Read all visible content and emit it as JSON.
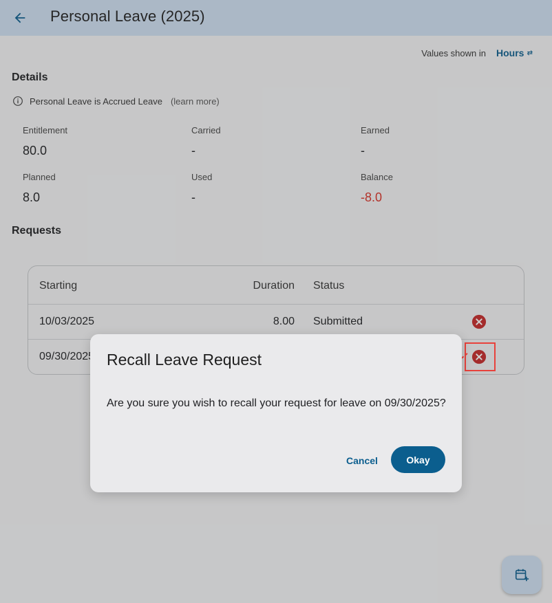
{
  "appbar": {
    "title": "Personal Leave (2025)"
  },
  "units": {
    "prefix": "Values shown in",
    "value": "Hours"
  },
  "details": {
    "title": "Details",
    "info_text": "Personal Leave is Accrued Leave",
    "learn_more": "(learn more)",
    "stats": [
      {
        "label": "Entitlement",
        "value": "80.0"
      },
      {
        "label": "Carried",
        "value": "-"
      },
      {
        "label": "Earned",
        "value": "-"
      },
      {
        "label": "Planned",
        "value": "8.0"
      },
      {
        "label": "Used",
        "value": "-"
      },
      {
        "label": "Balance",
        "value": "-8.0"
      }
    ]
  },
  "requests": {
    "title": "Requests",
    "headers": {
      "starting": "Starting",
      "duration": "Duration",
      "status": "Status"
    },
    "rows": [
      {
        "starting": "10/03/2025",
        "duration": "8.00",
        "status": "Submitted"
      },
      {
        "starting": "09/30/2025",
        "duration": "",
        "status": ""
      }
    ]
  },
  "dialog": {
    "title": "Recall Leave Request",
    "body": "Are you sure you wish to recall your request for leave on 09/30/2025?",
    "cancel_label": "Cancel",
    "okay_label": "Okay"
  },
  "colors": {
    "appbar": "#cfe0f2",
    "accent": "#0b5e8e",
    "negative": "#d93025",
    "cancel_icon": "#c62828",
    "annotation": "#e8413b"
  }
}
